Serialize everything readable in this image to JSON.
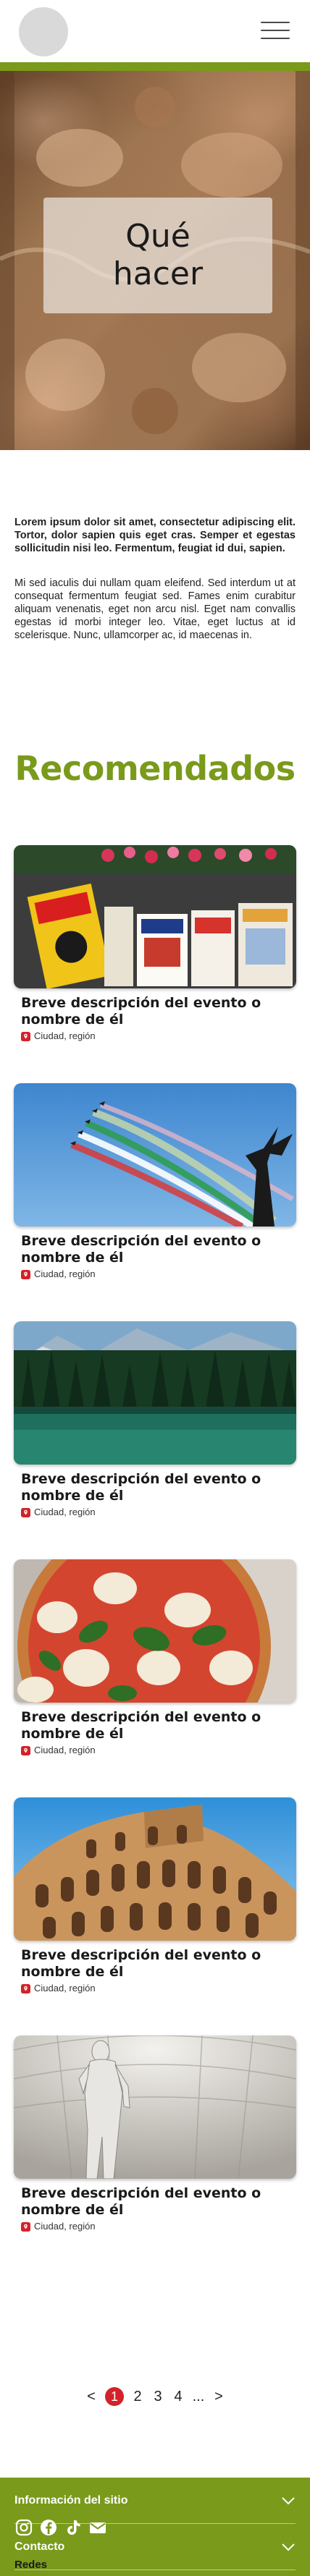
{
  "hero": {
    "title": "Qué hacer"
  },
  "intro": {
    "paragraph_bold": "Lorem ipsum dolor sit amet, consectetur adipiscing elit. Tortor, dolor sapien quis eget cras. Semper et egestas sollicitudin nisi leo. Fermentum, feugiat id dui, sapien.",
    "paragraph": "Mi sed iaculis dui nullam quam eleifend. Sed interdum ut at consequat fermentum feugiat sed. Fames enim curabitur aliquam venenatis, eget non arcu nisl. Eget nam convallis egestas id morbi integer leo. Vitae, eget luctus at id scelerisque. Nunc, ullamcorper ac, id maecenas in."
  },
  "recommended": {
    "title": "Recomendados",
    "cards": [
      {
        "title": "Breve descripción del evento o nombre de él",
        "location": "Ciudad, región",
        "image": "magazines-stand"
      },
      {
        "title": "Breve descripción del evento o nombre de él",
        "location": "Ciudad, región",
        "image": "aerobatic-jets-tricolor"
      },
      {
        "title": "Breve descripción del evento o nombre de él",
        "location": "Ciudad, región",
        "image": "alpine-lake"
      },
      {
        "title": "Breve descripción del evento o nombre de él",
        "location": "Ciudad, región",
        "image": "pizza-margherita"
      },
      {
        "title": "Breve descripción del evento o nombre de él",
        "location": "Ciudad, región",
        "image": "colosseum"
      },
      {
        "title": "Breve descripción del evento o nombre de él",
        "location": "Ciudad, región",
        "image": "david-statue"
      }
    ]
  },
  "pagination": {
    "prev": "<",
    "pages": [
      "1",
      "2",
      "3",
      "4"
    ],
    "ellipsis": "...",
    "next": ">",
    "current": "1"
  },
  "footer": {
    "site_info": "Información del sitio",
    "contact": "Contacto",
    "social_label": "Redes",
    "social_icons": [
      "instagram-icon",
      "facebook-icon",
      "tiktok-icon",
      "mail-icon"
    ]
  },
  "colors": {
    "brand_green": "#7a9a1b",
    "accent_red": "#d2232a"
  }
}
